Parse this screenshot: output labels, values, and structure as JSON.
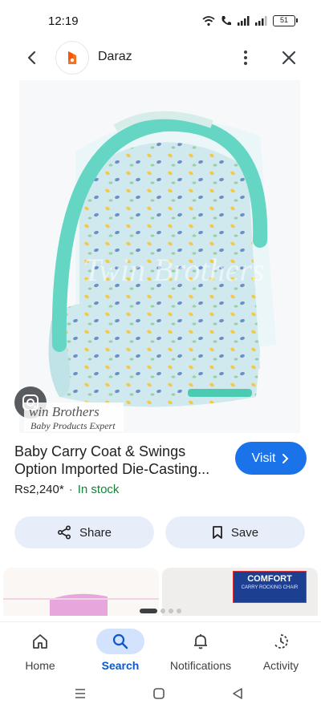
{
  "status_bar": {
    "time": "12:19",
    "battery": "51"
  },
  "header": {
    "site_name": "Daraz"
  },
  "hero": {
    "watermark_line1": "win Brothers",
    "watermark_line2": "Baby Products Expert"
  },
  "product": {
    "title": "Baby Carry Coat & Swings Option Imported Die-Casting...",
    "price": "Rs2,240*",
    "separator": "·",
    "stock": "In stock",
    "visit_label": "Visit"
  },
  "actions": {
    "share_label": "Share",
    "save_label": "Save"
  },
  "related": {
    "thumb_b_text": "COMFORT",
    "thumb_b_sub": "CARRY ROCKING CHAIR"
  },
  "bottom_nav": [
    {
      "label": "Home",
      "icon": "home-icon"
    },
    {
      "label": "Search",
      "icon": "search-icon",
      "active": true
    },
    {
      "label": "Notifications",
      "icon": "bell-icon"
    },
    {
      "label": "Activity",
      "icon": "activity-icon"
    }
  ],
  "colors": {
    "accent": "#1a73e8",
    "stock_green": "#188038",
    "chip_bg": "#e8eef9",
    "active_nav_bg": "#d3e3fd"
  }
}
